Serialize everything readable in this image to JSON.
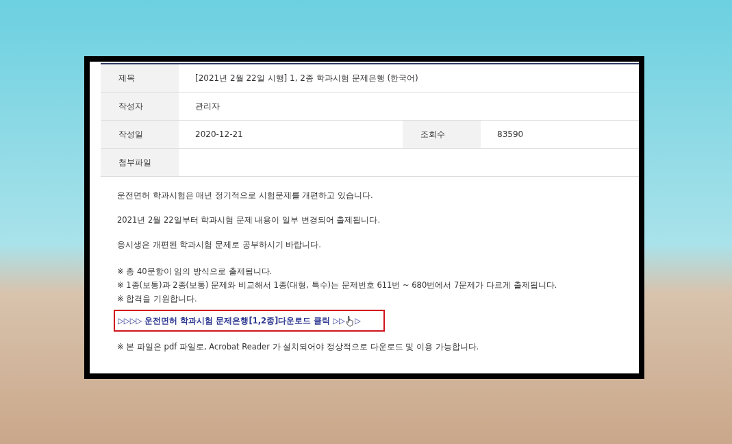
{
  "info_table": {
    "rows": [
      {
        "cells": [
          {
            "label": "제목",
            "value": "[2021년 2월 22일 시행] 1, 2종 학과시험 문제은행 (한국어)"
          }
        ]
      },
      {
        "cells": [
          {
            "label": "작성자",
            "value": "관리자"
          }
        ]
      },
      {
        "cells": [
          {
            "label": "작성일",
            "value": "2020-12-21"
          },
          {
            "label": "조회수",
            "value": "83590"
          }
        ]
      },
      {
        "cells": [
          {
            "label": "첨부파일"
          }
        ]
      }
    ]
  },
  "body": {
    "paragraphs": [
      "운전면허 학과시험은 매년 정기적으로 시험문제를 개편하고 있습니다.",
      "2021년 2월 22일부터 학과시험 문제 내용이 일부 변경되어 출제됩니다.",
      "응시생은 개편된 학과시험 문제로 공부하시기 바랍니다."
    ],
    "notes": [
      "※ 총 40문항이 임의 방식으로 출제됩니다.",
      "※ 1종(보통)과 2종(보통) 문제와 비교해서 1종(대형, 특수)는 문제번호     611번 ~ 680번에서 7문제가 다르게 출제됩니다.",
      "※ 합격을 기원합니다."
    ],
    "download_link": {
      "text": "▷▷▷▷ 운전면허 학과시험 문제은행[1,2종]다운로드 클릭 ▷▷",
      "text_after_cursor": "▷"
    },
    "footnote": "※ 본 파일은 pdf 파일로, Acrobat Reader 가 설치되어야 정상적으로 다운로드 및 이용 가능합니다."
  }
}
